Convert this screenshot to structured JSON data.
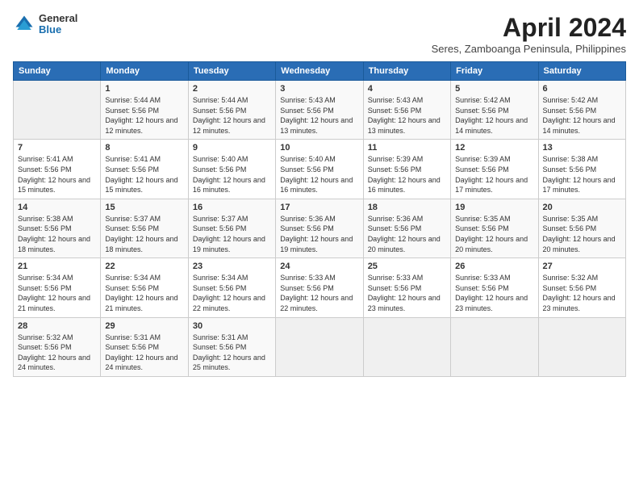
{
  "logo": {
    "general": "General",
    "blue": "Blue"
  },
  "title": {
    "month": "April 2024",
    "location": "Seres, Zamboanga Peninsula, Philippines"
  },
  "headers": [
    "Sunday",
    "Monday",
    "Tuesday",
    "Wednesday",
    "Thursday",
    "Friday",
    "Saturday"
  ],
  "weeks": [
    [
      {
        "day": "",
        "sunrise": "",
        "sunset": "",
        "daylight": ""
      },
      {
        "day": "1",
        "sunrise": "Sunrise: 5:44 AM",
        "sunset": "Sunset: 5:56 PM",
        "daylight": "Daylight: 12 hours and 12 minutes."
      },
      {
        "day": "2",
        "sunrise": "Sunrise: 5:44 AM",
        "sunset": "Sunset: 5:56 PM",
        "daylight": "Daylight: 12 hours and 12 minutes."
      },
      {
        "day": "3",
        "sunrise": "Sunrise: 5:43 AM",
        "sunset": "Sunset: 5:56 PM",
        "daylight": "Daylight: 12 hours and 13 minutes."
      },
      {
        "day": "4",
        "sunrise": "Sunrise: 5:43 AM",
        "sunset": "Sunset: 5:56 PM",
        "daylight": "Daylight: 12 hours and 13 minutes."
      },
      {
        "day": "5",
        "sunrise": "Sunrise: 5:42 AM",
        "sunset": "Sunset: 5:56 PM",
        "daylight": "Daylight: 12 hours and 14 minutes."
      },
      {
        "day": "6",
        "sunrise": "Sunrise: 5:42 AM",
        "sunset": "Sunset: 5:56 PM",
        "daylight": "Daylight: 12 hours and 14 minutes."
      }
    ],
    [
      {
        "day": "7",
        "sunrise": "Sunrise: 5:41 AM",
        "sunset": "Sunset: 5:56 PM",
        "daylight": "Daylight: 12 hours and 15 minutes."
      },
      {
        "day": "8",
        "sunrise": "Sunrise: 5:41 AM",
        "sunset": "Sunset: 5:56 PM",
        "daylight": "Daylight: 12 hours and 15 minutes."
      },
      {
        "day": "9",
        "sunrise": "Sunrise: 5:40 AM",
        "sunset": "Sunset: 5:56 PM",
        "daylight": "Daylight: 12 hours and 16 minutes."
      },
      {
        "day": "10",
        "sunrise": "Sunrise: 5:40 AM",
        "sunset": "Sunset: 5:56 PM",
        "daylight": "Daylight: 12 hours and 16 minutes."
      },
      {
        "day": "11",
        "sunrise": "Sunrise: 5:39 AM",
        "sunset": "Sunset: 5:56 PM",
        "daylight": "Daylight: 12 hours and 16 minutes."
      },
      {
        "day": "12",
        "sunrise": "Sunrise: 5:39 AM",
        "sunset": "Sunset: 5:56 PM",
        "daylight": "Daylight: 12 hours and 17 minutes."
      },
      {
        "day": "13",
        "sunrise": "Sunrise: 5:38 AM",
        "sunset": "Sunset: 5:56 PM",
        "daylight": "Daylight: 12 hours and 17 minutes."
      }
    ],
    [
      {
        "day": "14",
        "sunrise": "Sunrise: 5:38 AM",
        "sunset": "Sunset: 5:56 PM",
        "daylight": "Daylight: 12 hours and 18 minutes."
      },
      {
        "day": "15",
        "sunrise": "Sunrise: 5:37 AM",
        "sunset": "Sunset: 5:56 PM",
        "daylight": "Daylight: 12 hours and 18 minutes."
      },
      {
        "day": "16",
        "sunrise": "Sunrise: 5:37 AM",
        "sunset": "Sunset: 5:56 PM",
        "daylight": "Daylight: 12 hours and 19 minutes."
      },
      {
        "day": "17",
        "sunrise": "Sunrise: 5:36 AM",
        "sunset": "Sunset: 5:56 PM",
        "daylight": "Daylight: 12 hours and 19 minutes."
      },
      {
        "day": "18",
        "sunrise": "Sunrise: 5:36 AM",
        "sunset": "Sunset: 5:56 PM",
        "daylight": "Daylight: 12 hours and 20 minutes."
      },
      {
        "day": "19",
        "sunrise": "Sunrise: 5:35 AM",
        "sunset": "Sunset: 5:56 PM",
        "daylight": "Daylight: 12 hours and 20 minutes."
      },
      {
        "day": "20",
        "sunrise": "Sunrise: 5:35 AM",
        "sunset": "Sunset: 5:56 PM",
        "daylight": "Daylight: 12 hours and 20 minutes."
      }
    ],
    [
      {
        "day": "21",
        "sunrise": "Sunrise: 5:34 AM",
        "sunset": "Sunset: 5:56 PM",
        "daylight": "Daylight: 12 hours and 21 minutes."
      },
      {
        "day": "22",
        "sunrise": "Sunrise: 5:34 AM",
        "sunset": "Sunset: 5:56 PM",
        "daylight": "Daylight: 12 hours and 21 minutes."
      },
      {
        "day": "23",
        "sunrise": "Sunrise: 5:34 AM",
        "sunset": "Sunset: 5:56 PM",
        "daylight": "Daylight: 12 hours and 22 minutes."
      },
      {
        "day": "24",
        "sunrise": "Sunrise: 5:33 AM",
        "sunset": "Sunset: 5:56 PM",
        "daylight": "Daylight: 12 hours and 22 minutes."
      },
      {
        "day": "25",
        "sunrise": "Sunrise: 5:33 AM",
        "sunset": "Sunset: 5:56 PM",
        "daylight": "Daylight: 12 hours and 23 minutes."
      },
      {
        "day": "26",
        "sunrise": "Sunrise: 5:33 AM",
        "sunset": "Sunset: 5:56 PM",
        "daylight": "Daylight: 12 hours and 23 minutes."
      },
      {
        "day": "27",
        "sunrise": "Sunrise: 5:32 AM",
        "sunset": "Sunset: 5:56 PM",
        "daylight": "Daylight: 12 hours and 23 minutes."
      }
    ],
    [
      {
        "day": "28",
        "sunrise": "Sunrise: 5:32 AM",
        "sunset": "Sunset: 5:56 PM",
        "daylight": "Daylight: 12 hours and 24 minutes."
      },
      {
        "day": "29",
        "sunrise": "Sunrise: 5:31 AM",
        "sunset": "Sunset: 5:56 PM",
        "daylight": "Daylight: 12 hours and 24 minutes."
      },
      {
        "day": "30",
        "sunrise": "Sunrise: 5:31 AM",
        "sunset": "Sunset: 5:56 PM",
        "daylight": "Daylight: 12 hours and 25 minutes."
      },
      {
        "day": "",
        "sunrise": "",
        "sunset": "",
        "daylight": ""
      },
      {
        "day": "",
        "sunrise": "",
        "sunset": "",
        "daylight": ""
      },
      {
        "day": "",
        "sunrise": "",
        "sunset": "",
        "daylight": ""
      },
      {
        "day": "",
        "sunrise": "",
        "sunset": "",
        "daylight": ""
      }
    ]
  ]
}
